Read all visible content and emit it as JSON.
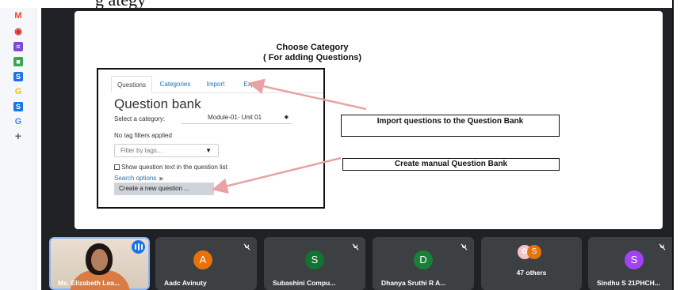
{
  "caption_fragment": "g                                                                         ategy",
  "sidebar": {
    "icons": [
      {
        "name": "gmail-icon",
        "glyph": "M",
        "color": "#ea4335"
      },
      {
        "name": "record-icon",
        "glyph": "◉",
        "color": "#d93025"
      },
      {
        "name": "list-app-icon",
        "glyph": "≡",
        "color": "#7b4bd6"
      },
      {
        "name": "meet-icon",
        "glyph": "■",
        "color": "#34a853"
      },
      {
        "name": "s-app-icon",
        "glyph": "S",
        "color": "#1a73e8"
      },
      {
        "name": "google-icon",
        "glyph": "G",
        "color": "#fbbc04"
      },
      {
        "name": "s-app-icon-2",
        "glyph": "S",
        "color": "#1a73e8"
      },
      {
        "name": "google-icon-2",
        "glyph": "G",
        "color": "#4285f4"
      },
      {
        "name": "add-icon",
        "glyph": "+",
        "color": "#5f6368"
      }
    ]
  },
  "slide": {
    "title_line1": "Choose Category",
    "title_line2": "( For adding Questions)",
    "tabs": [
      "Questions",
      "Categories",
      "Import",
      "Export"
    ],
    "heading": "Question bank",
    "category_label": "Select a category:",
    "category_value": "Module-01- Unit 01",
    "no_tag": "No tag filters applied",
    "filter_placeholder": "Filter by tags...",
    "show_text": "Show question text in the question list",
    "search_options": "Search options",
    "create_button": "Create a new question ...",
    "callout_import": "Import questions to the Question Bank",
    "callout_create": "Create manual Question Bank"
  },
  "participants": {
    "presenter": "Ms. Elizabeth Lea...",
    "tiles": [
      {
        "initial": "A",
        "name": "Aadc Avinuty",
        "color": "#e8710a"
      },
      {
        "initial": "S",
        "name": "Subashini Compu...",
        "color": "#137333"
      },
      {
        "initial": "D",
        "name": "Dhanya Sruthi R A...",
        "color": "#188038"
      },
      {
        "initial": "S",
        "name": "Sindhu S 21PHCH...",
        "color": "#a142f4"
      }
    ],
    "others": {
      "label": "47 others",
      "avatar_initial": "S",
      "avatar_color": "#e8710a"
    }
  }
}
